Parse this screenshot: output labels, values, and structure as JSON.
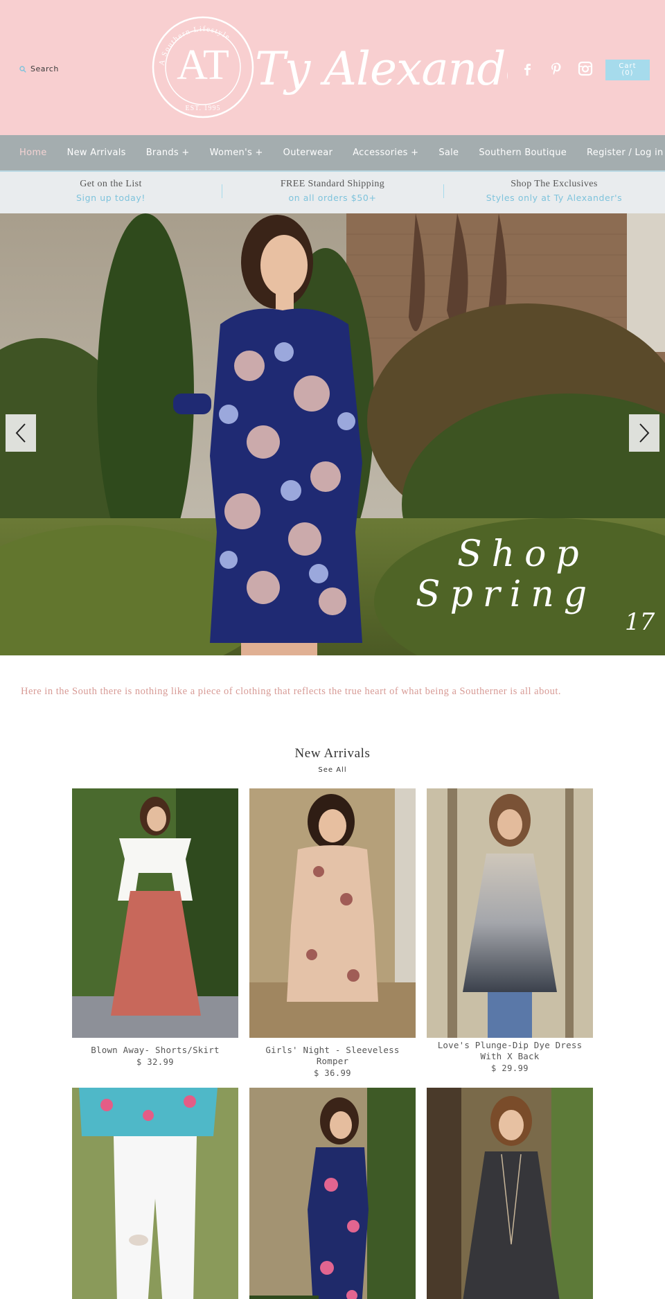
{
  "header": {
    "search_label": "Search",
    "logo_monogram": "AT",
    "logo_ring_text": "A Southern Lifestyle",
    "logo_ring_text_2": "Faith · Family · Fashion",
    "logo_est": "EST. 1995",
    "brand_name": "Ty Alexander's",
    "cart_label": "Cart",
    "cart_count": "(0)",
    "social_icons": [
      "facebook-icon",
      "pinterest-icon",
      "instagram-icon"
    ]
  },
  "nav": {
    "items": [
      {
        "label": "Home"
      },
      {
        "label": "New Arrivals"
      },
      {
        "label": "Brands +"
      },
      {
        "label": "Women's +"
      },
      {
        "label": "Outerwear"
      },
      {
        "label": "Accessories +"
      },
      {
        "label": "Sale"
      },
      {
        "label": "Southern Boutique"
      },
      {
        "label": "Register / Log in"
      }
    ]
  },
  "promo": [
    {
      "title": "Get on the List",
      "subtitle": "Sign up today!"
    },
    {
      "title": "FREE Standard Shipping",
      "subtitle": "on all orders $50+"
    },
    {
      "title": "Shop The Exclusives",
      "subtitle": "Styles only at Ty Alexander's"
    }
  ],
  "hero": {
    "line1": "Shop",
    "line2": "Spring",
    "line3": "17"
  },
  "tagline": "Here in the South there is nothing like a piece of clothing that reflects the true heart of what being a Southerner is all about.",
  "new_arrivals": {
    "title": "New Arrivals",
    "see_all": "See All",
    "products": [
      {
        "name": "Blown Away- Shorts/Skirt",
        "price": "$ 32.99"
      },
      {
        "name": "Girls' Night - Sleeveless Romper",
        "price": "$ 36.99"
      },
      {
        "name": "Love's Plunge-Dip Dye Dress With X Back",
        "price": "$ 29.99"
      },
      {
        "name": "",
        "price": ""
      },
      {
        "name": "",
        "price": ""
      },
      {
        "name": "",
        "price": ""
      }
    ]
  },
  "colors": {
    "header_bg": "#f8cfd0",
    "nav_bg": "#a4adaf",
    "promo_bg": "#e9ecee",
    "accent_blue": "#7ec3dc",
    "tagline_pink": "#d79a95",
    "cart_bg": "#a6dbec"
  }
}
